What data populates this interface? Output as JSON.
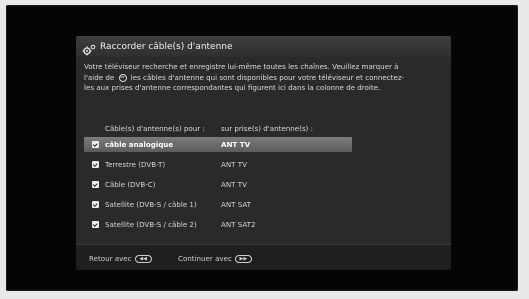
{
  "dialog": {
    "title": "Raccorder câble(s) d'antenne",
    "title_icon": "gears-icon",
    "description_line1": "Votre téléviseur recherche et enregistre lui-même toutes les chaînes. Veuillez marquer à",
    "description_line2_before": "l'aide de",
    "description_line2_icon": "ok-button-icon",
    "description_line2_after": "les câbles d'antenne qui sont disponibles pour votre téléviseur et connectez-",
    "description_line3": "les aux prises d'antenne correspondantes qui figurent ici dans la colonne de droite.",
    "columns": {
      "cable": "Câble(s) d'antenne(s) pour :",
      "port": "sur prise(s) d'antenne(s) :"
    },
    "rows": [
      {
        "label": "câble analogique",
        "port": "ANT TV",
        "checked": true,
        "selected": true
      },
      {
        "label": "Terrestre (DVB-T)",
        "port": "ANT TV",
        "checked": true,
        "selected": false
      },
      {
        "label": "Câble (DVB-C)",
        "port": "ANT TV",
        "checked": true,
        "selected": false
      },
      {
        "label": "Satellite (DVB-S / câble 1)",
        "port": "ANT SAT",
        "checked": true,
        "selected": false
      },
      {
        "label": "Satellite (DVB-S / câble 2)",
        "port": "ANT SAT2",
        "checked": true,
        "selected": false
      }
    ],
    "footer": {
      "back_label": "Retour avec",
      "back_key_icon": "rewind-key-icon",
      "continue_label": "Continuer avec",
      "continue_key_icon": "fast-forward-key-icon"
    }
  }
}
